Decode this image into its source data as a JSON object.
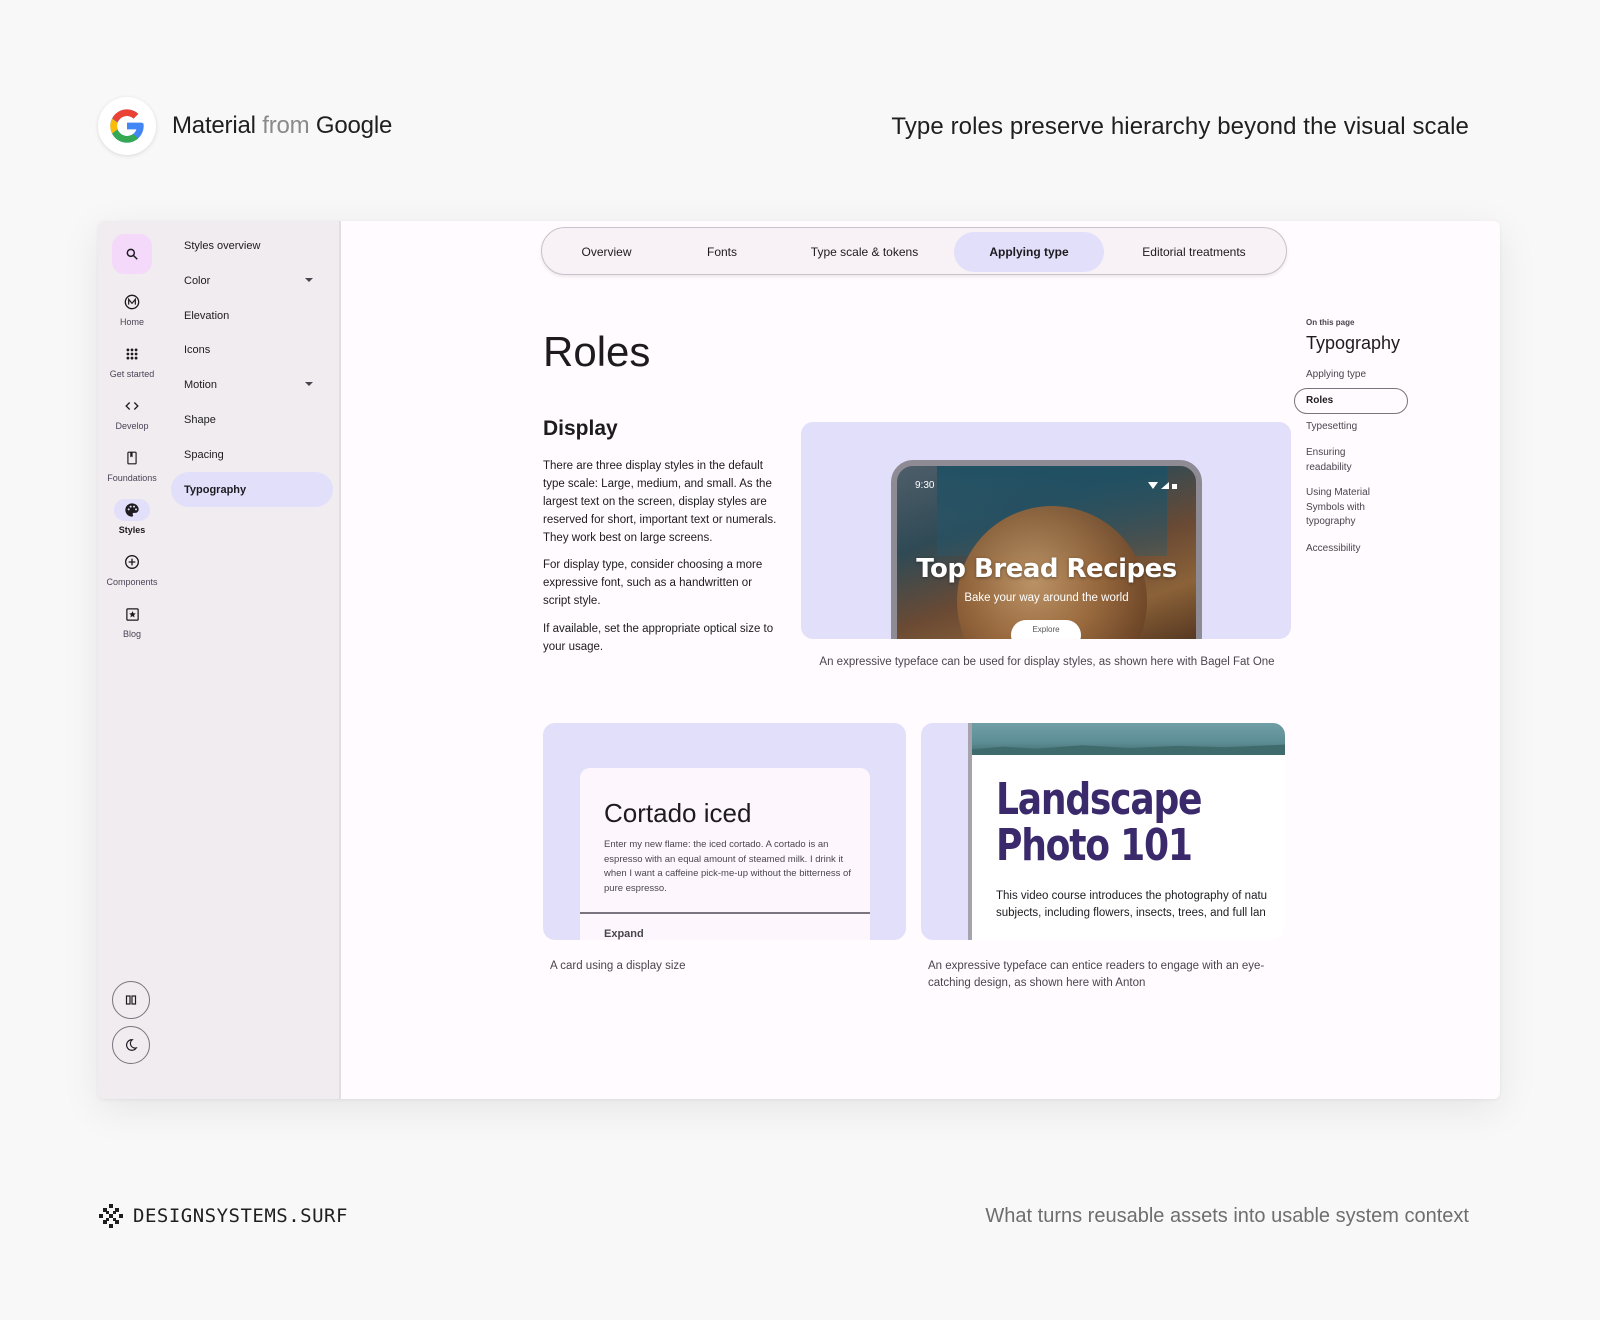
{
  "brand": {
    "material": "Material",
    "from": "from",
    "google": "Google"
  },
  "tagline": "Type roles preserve hierarchy beyond the visual scale",
  "rail": {
    "items": [
      {
        "label": "Home",
        "icon": "material-m-icon"
      },
      {
        "label": "Get started",
        "icon": "apps-grid-icon"
      },
      {
        "label": "Develop",
        "icon": "code-icon"
      },
      {
        "label": "Foundations",
        "icon": "book-icon"
      },
      {
        "label": "Styles",
        "icon": "palette-icon",
        "active": true
      },
      {
        "label": "Components",
        "icon": "add-circle-icon"
      },
      {
        "label": "Blog",
        "icon": "star-box-icon"
      }
    ]
  },
  "sidenav": {
    "items": [
      {
        "label": "Styles overview"
      },
      {
        "label": "Color",
        "expandable": true
      },
      {
        "label": "Elevation"
      },
      {
        "label": "Icons"
      },
      {
        "label": "Motion",
        "expandable": true
      },
      {
        "label": "Shape"
      },
      {
        "label": "Spacing"
      },
      {
        "label": "Typography",
        "active": true
      }
    ]
  },
  "tabs": [
    {
      "label": "Overview"
    },
    {
      "label": "Fonts"
    },
    {
      "label": "Type scale & tokens"
    },
    {
      "label": "Applying type",
      "active": true
    },
    {
      "label": "Editorial treatments"
    }
  ],
  "content": {
    "title": "Roles",
    "section": "Display",
    "paragraphs": [
      "There are three display styles in the default type scale: Large, medium, and small. As the largest text on the screen, display styles are reserved for short, important text or numerals. They work best on large screens.",
      "For display type, consider choosing a more expressive font, such as a handwritten or script style.",
      "If available, set the appropriate optical size to your usage."
    ],
    "hero": {
      "time": "9:30",
      "title": "Top Bread Recipes",
      "subtitle": "Bake your way around the world",
      "cta": "Explore",
      "caption": "An expressive typeface can be used for display styles, as shown here with Bagel Fat One"
    },
    "card_example": {
      "title": "Cortado iced",
      "body": "Enter my new flame: the iced cortado. A cortado is an espresso with an equal amount of steamed milk. I drink it when I want a caffeine pick-me-up without the bitterness of pure espresso.",
      "action": "Expand",
      "caption": "A card using a display size"
    },
    "landscape": {
      "title_line1": "Landscape",
      "title_line2": "Photo 101",
      "body_line1": "This video course introduces the photography of natu",
      "body_line2": "subjects, including flowers, insects, trees, and full lan",
      "caption": "An expressive typeface can entice readers to engage with an eye-catching design, as shown here with Anton"
    }
  },
  "on_this_page": {
    "label": "On this page",
    "title": "Typography",
    "items": [
      {
        "label": "Applying type"
      },
      {
        "label": "Roles",
        "active": true
      },
      {
        "label": "Typesetting"
      },
      {
        "label": "Ensuring readability"
      },
      {
        "label": "Using Material Symbols with typography"
      },
      {
        "label": "Accessibility"
      }
    ]
  },
  "footer": {
    "logo": "DESIGNSYSTEMS.SURF",
    "tagline": "What turns reusable assets into usable system context"
  },
  "colors": {
    "accent": "#e2dffa",
    "search_bg": "#f5d9fb",
    "rail_bg": "#f1ecef",
    "surface": "#fffbfe"
  }
}
